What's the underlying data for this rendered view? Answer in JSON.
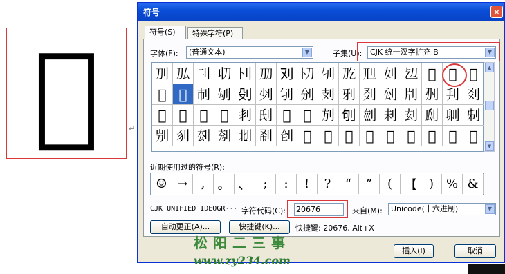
{
  "preview": {
    "glyph": "𠚶"
  },
  "paragraph_mark": "↵",
  "dialog": {
    "title": "符号",
    "close": "✕",
    "tabs": [
      "符号(S)",
      "特殊字符(P)"
    ],
    "font_label": "字体(F):",
    "font_value": "(普通文本)",
    "subset_label": "子集(U):",
    "subset_value": "CJK 统一汉字扩充 B",
    "grid": [
      [
        "𠚥",
        "𠚦",
        "𠚧",
        "𠚨",
        "𠚩",
        "𠚪",
        "𠚫",
        "𠚬",
        "𠚭",
        "𠚮",
        "𠚯",
        "𠚰",
        "𠚱",
        "𠚲",
        "𠚳",
        "𠚴"
      ],
      [
        "𠚵",
        "𠚶",
        "𠚷",
        "𠚸",
        "𠚹",
        "𠚺",
        "𠚻",
        "𠚼",
        "𠚽",
        "𠚾",
        "𠚿",
        "𠛀",
        "𠛁",
        "𠛂",
        "𠛃",
        "𠛄"
      ],
      [
        "𠛅",
        "𠛆",
        "𠛇",
        "𠛈",
        "𠛉",
        "𠛊",
        "𠛋",
        "𠛌",
        "𠛍",
        "𠛎",
        "𠛏",
        "𠛐",
        "𠛑",
        "𠛒",
        "𠛓",
        "𠛔"
      ],
      [
        "𠛕",
        "𠛖",
        "𠛗",
        "𠛘",
        "𠛙",
        "𠛚",
        "𠛛",
        "𠛜",
        "𠛝",
        "𠛞",
        "𠛟",
        "𠛠",
        "𠛡",
        "𠛢",
        "𠛣",
        "𠛤"
      ]
    ],
    "selected_cell": "𠚶",
    "recent_label": "近期使用过的符号(R):",
    "recent": [
      "☺",
      "→",
      ",",
      "。",
      "、",
      ";",
      ":",
      "!",
      "?",
      "“",
      "”",
      "(",
      "【",
      ")",
      "%",
      "&"
    ],
    "char_name": "CJK UNIFIED IDEOGR···",
    "code_label": "字符代码(C):",
    "code_value": "20676",
    "from_label": "来自(M):",
    "from_value": "Unicode(十六进制)",
    "autocorrect_button": "自动更正(A)...",
    "shortcut_button": "快捷键(K)...",
    "shortcut_text": "快捷键: 20676, Alt+X",
    "insert_button": "插入(I)",
    "cancel_button": "取消"
  },
  "watermark": {
    "line1": "松阳二三事",
    "line2": "www.zy234.com"
  }
}
